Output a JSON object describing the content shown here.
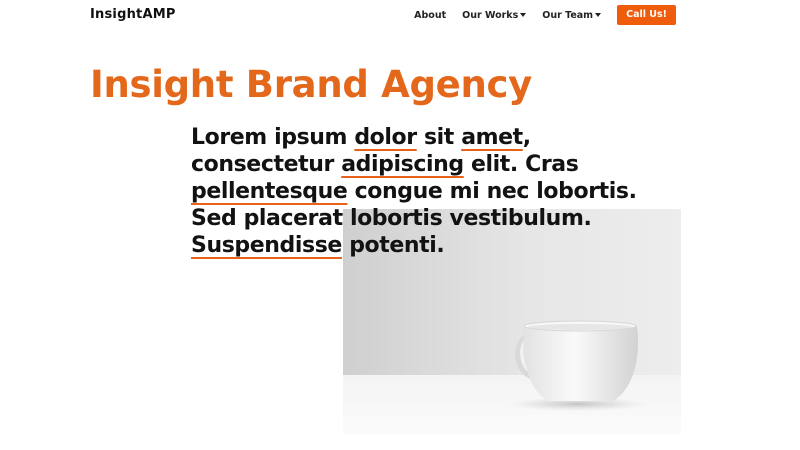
{
  "header": {
    "brand": "InsightAMP",
    "nav": [
      {
        "label": "About",
        "has_dropdown": false
      },
      {
        "label": "Our Works",
        "has_dropdown": true
      },
      {
        "label": "Our Team",
        "has_dropdown": true
      }
    ],
    "cta_label": "Call Us!",
    "accent_color": "#ee5c0c"
  },
  "hero": {
    "title": "Insight Brand Agency",
    "lead_segments": [
      {
        "text": "Lorem ipsum ",
        "underline": false
      },
      {
        "text": "dolor",
        "underline": true
      },
      {
        "text": " sit ",
        "underline": false
      },
      {
        "text": "amet",
        "underline": true
      },
      {
        "text": ", consectetur ",
        "underline": false
      },
      {
        "text": "adipiscing",
        "underline": true
      },
      {
        "text": " elit. Cras ",
        "underline": false
      },
      {
        "text": "pellentesque",
        "underline": true
      },
      {
        "text": " congue mi nec lobortis. Sed placerat lobortis vestibulum. ",
        "underline": false
      },
      {
        "text": "Suspendisse",
        "underline": true
      },
      {
        "text": " potenti.",
        "underline": false
      }
    ],
    "image": "coffee-mug-photo"
  }
}
